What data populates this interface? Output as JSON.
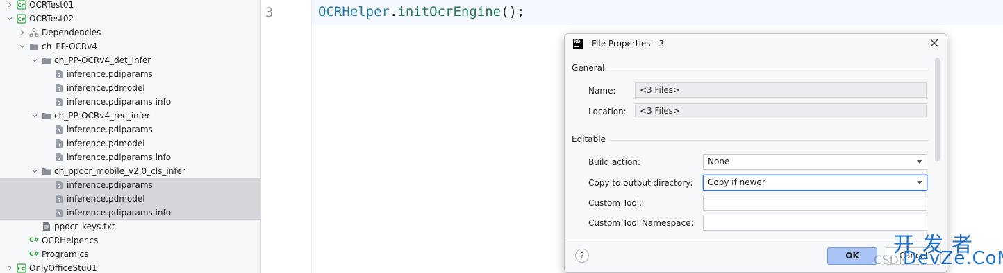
{
  "explorer": {
    "items": [
      {
        "label": "OCRTest01",
        "icon": "csharp-project-icon",
        "chevron": "right",
        "selected": false
      },
      {
        "label": "OCRTest02",
        "icon": "csharp-project-icon",
        "chevron": "down",
        "selected": false
      },
      {
        "label": "Dependencies",
        "icon": "dependencies-icon",
        "chevron": "right",
        "selected": false
      },
      {
        "label": "ch_PP-OCRv4",
        "icon": "folder-icon",
        "chevron": "down",
        "selected": false
      },
      {
        "label": "ch_PP-OCRv4_det_infer",
        "icon": "folder-icon",
        "chevron": "down",
        "selected": false
      },
      {
        "label": "inference.pdiparams",
        "icon": "unknown-file-icon",
        "chevron": "none",
        "selected": false
      },
      {
        "label": "inference.pdmodel",
        "icon": "unknown-file-icon",
        "chevron": "none",
        "selected": false
      },
      {
        "label": "inference.pdiparams.info",
        "icon": "unknown-file-icon",
        "chevron": "none",
        "selected": false
      },
      {
        "label": "ch_PP-OCRv4_rec_infer",
        "icon": "folder-icon",
        "chevron": "down",
        "selected": false
      },
      {
        "label": "inference.pdiparams",
        "icon": "unknown-file-icon",
        "chevron": "none",
        "selected": false
      },
      {
        "label": "inference.pdmodel",
        "icon": "unknown-file-icon",
        "chevron": "none",
        "selected": false
      },
      {
        "label": "inference.pdiparams.info",
        "icon": "unknown-file-icon",
        "chevron": "none",
        "selected": false
      },
      {
        "label": "ch_ppocr_mobile_v2.0_cls_infer",
        "icon": "folder-icon",
        "chevron": "down",
        "selected": false
      },
      {
        "label": "inference.pdiparams",
        "icon": "unknown-file-icon",
        "chevron": "none",
        "selected": true
      },
      {
        "label": "inference.pdmodel",
        "icon": "unknown-file-icon",
        "chevron": "none",
        "selected": true
      },
      {
        "label": "inference.pdiparams.info",
        "icon": "unknown-file-icon",
        "chevron": "none",
        "selected": true
      },
      {
        "label": "ppocr_keys.txt",
        "icon": "text-file-icon",
        "chevron": "none",
        "selected": false
      },
      {
        "label": "OCRHelper.cs",
        "icon": "csharp-file-icon",
        "chevron": "none",
        "selected": false
      },
      {
        "label": "Program.cs",
        "icon": "csharp-file-icon",
        "chevron": "none",
        "selected": false
      },
      {
        "label": "OnlyOfficeStu01",
        "icon": "csharp-project-icon",
        "chevron": "right",
        "selected": false
      }
    ]
  },
  "editor": {
    "line_number": "3",
    "code": {
      "class_name": "OCRHelper",
      "dot": ".",
      "method": "initOcrEngine",
      "tail": "();"
    }
  },
  "dialog": {
    "logo_text": "RD",
    "title": "File Properties - 3",
    "general_section": "General",
    "name_label": "Name:",
    "name_value": "<3 Files>",
    "location_label": "Location:",
    "location_value": "<3 Files>",
    "editable_section": "Editable",
    "build_action_label": "Build action:",
    "build_action_value": "None",
    "copy_label": "Copy to output directory:",
    "copy_value": "Copy if newer",
    "custom_tool_label": "Custom Tool:",
    "custom_tool_value": "",
    "custom_ns_label": "Custom Tool Namespace:",
    "custom_ns_value": "",
    "help_label": "?",
    "ok_label": "OK",
    "cancel_label": "Cancel"
  },
  "watermark": {
    "chinese": "开发者",
    "csdn": "CSDN",
    "domain": "DevZe.CoM"
  },
  "colors": {
    "selection": "#d4d6db",
    "csharp_green": "#3aa54a",
    "ok_button": "#a9c4f5",
    "watermark_blue": "#1f6fc5"
  }
}
